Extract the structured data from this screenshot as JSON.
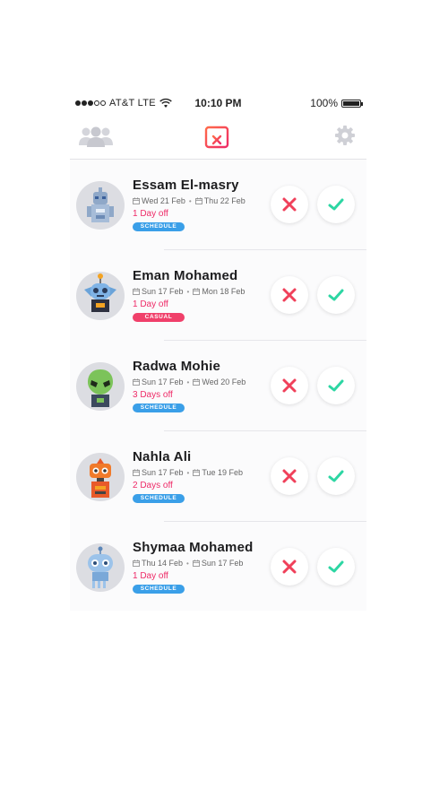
{
  "status_bar": {
    "carrier": "AT&T LTE",
    "time": "10:10 PM",
    "battery": "100%",
    "battery_level": 1.0
  },
  "navbar": {
    "left_icon": "team-icon",
    "center_icon": "calendar-reject-icon",
    "right_icon": "gear-icon"
  },
  "colors": {
    "accent_pink": "#ee2a67",
    "approve_green": "#2dd6a3",
    "reject_red": "#f0405a",
    "schedule_blue": "#3a9fe8",
    "casual_pink": "#f0406a"
  },
  "requests": [
    {
      "name": "Essam El-masry",
      "from": "Wed 21 Feb",
      "to": "Thu 22 Feb",
      "days": "1 Day off",
      "badge": "SCHEDULE",
      "badge_type": "schedule",
      "avatar_icon": "robot-gray-icon"
    },
    {
      "name": "Eman Mohamed",
      "from": "Sun 17 Feb",
      "to": "Mon 18 Feb",
      "days": "1 Day off",
      "badge": "CASUAL",
      "badge_type": "casual",
      "avatar_icon": "robot-blue-antenna-icon"
    },
    {
      "name": "Radwa Mohie",
      "from": "Sun 17 Feb",
      "to": "Wed 20 Feb",
      "days": "3 Days off",
      "badge": "SCHEDULE",
      "badge_type": "schedule",
      "avatar_icon": "alien-green-icon"
    },
    {
      "name": "Nahla Ali",
      "from": "Sun 17 Feb",
      "to": "Tue 19 Feb",
      "days": "2 Days off",
      "badge": "SCHEDULE",
      "badge_type": "schedule",
      "avatar_icon": "robot-orange-icon"
    },
    {
      "name": "Shymaa Mohamed",
      "from": "Thu 14 Feb",
      "to": "Sun 17 Feb",
      "days": "1 Day off",
      "badge": "SCHEDULE",
      "badge_type": "schedule",
      "avatar_icon": "robot-lightblue-icon"
    }
  ]
}
